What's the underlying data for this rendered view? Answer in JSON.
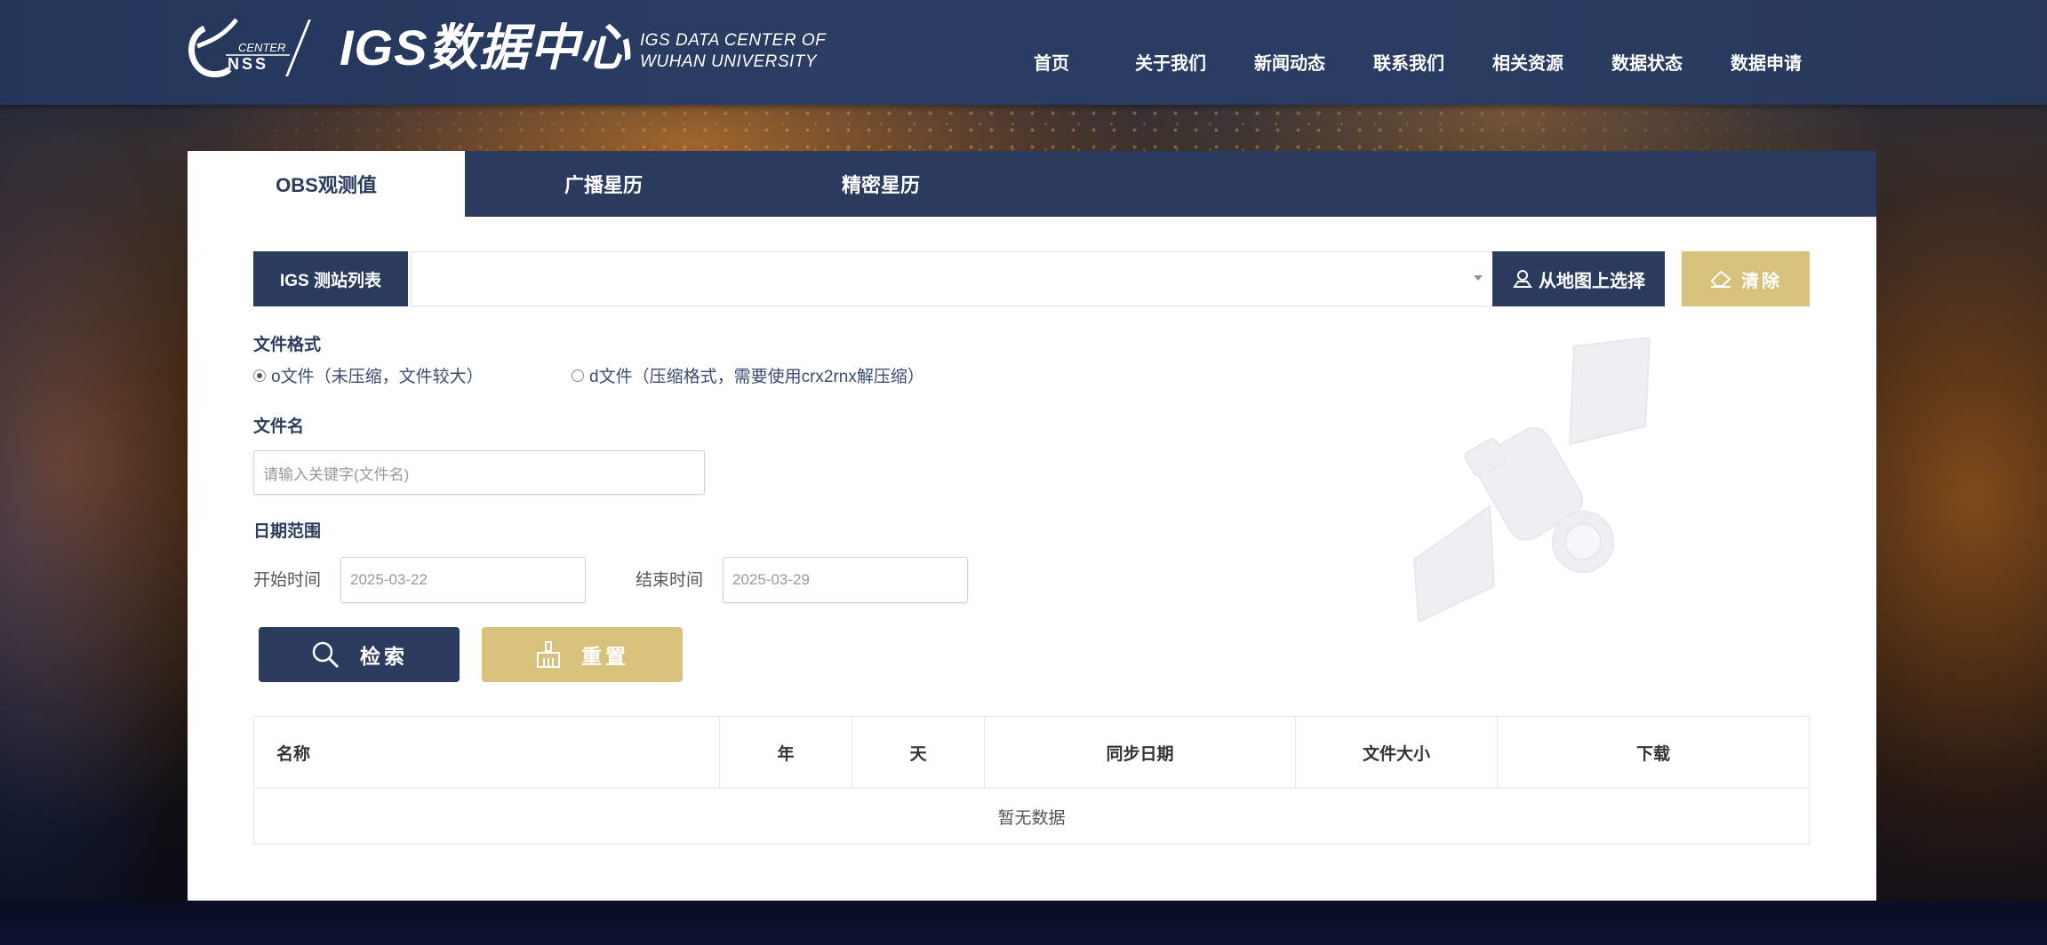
{
  "header": {
    "logo_small_top": "CENTER",
    "logo_small_bottom": "NSS",
    "logo_title": "IGS数据中心",
    "logo_subtitle_line1": "IGS DATA CENTER OF",
    "logo_subtitle_line2": "WUHAN UNIVERSITY",
    "nav": [
      {
        "label": "首页"
      },
      {
        "label": "关于我们"
      },
      {
        "label": "新闻动态"
      },
      {
        "label": "联系我们"
      },
      {
        "label": "相关资源"
      },
      {
        "label": "数据状态"
      },
      {
        "label": "数据申请"
      }
    ]
  },
  "tabs": [
    {
      "label": "OBS观测值",
      "active": true
    },
    {
      "label": "广播星历",
      "active": false
    },
    {
      "label": "精密星历",
      "active": false
    }
  ],
  "station": {
    "label": "IGS 测站列表",
    "value": "",
    "map_button": "从地图上选择",
    "clear_button": "清除"
  },
  "file_format": {
    "label": "文件格式",
    "options": [
      {
        "label": "o文件（未压缩，文件较大）",
        "selected": true
      },
      {
        "label": "d文件（压缩格式，需要使用crx2rnx解压缩）",
        "selected": false
      }
    ]
  },
  "file_name": {
    "label": "文件名",
    "placeholder": "请输入关键字(文件名)"
  },
  "date_range": {
    "label": "日期范围",
    "start_label": "开始时间",
    "start_value": "2025-03-22",
    "end_label": "结束时间",
    "end_value": "2025-03-29"
  },
  "actions": {
    "search": "检索",
    "reset": "重置"
  },
  "table": {
    "columns": [
      "名称",
      "年",
      "天",
      "同步日期",
      "文件大小",
      "下载"
    ],
    "empty_text": "暂无数据"
  },
  "colors": {
    "primary": "#2a3b5e",
    "accent_gold": "#d6c27a"
  }
}
